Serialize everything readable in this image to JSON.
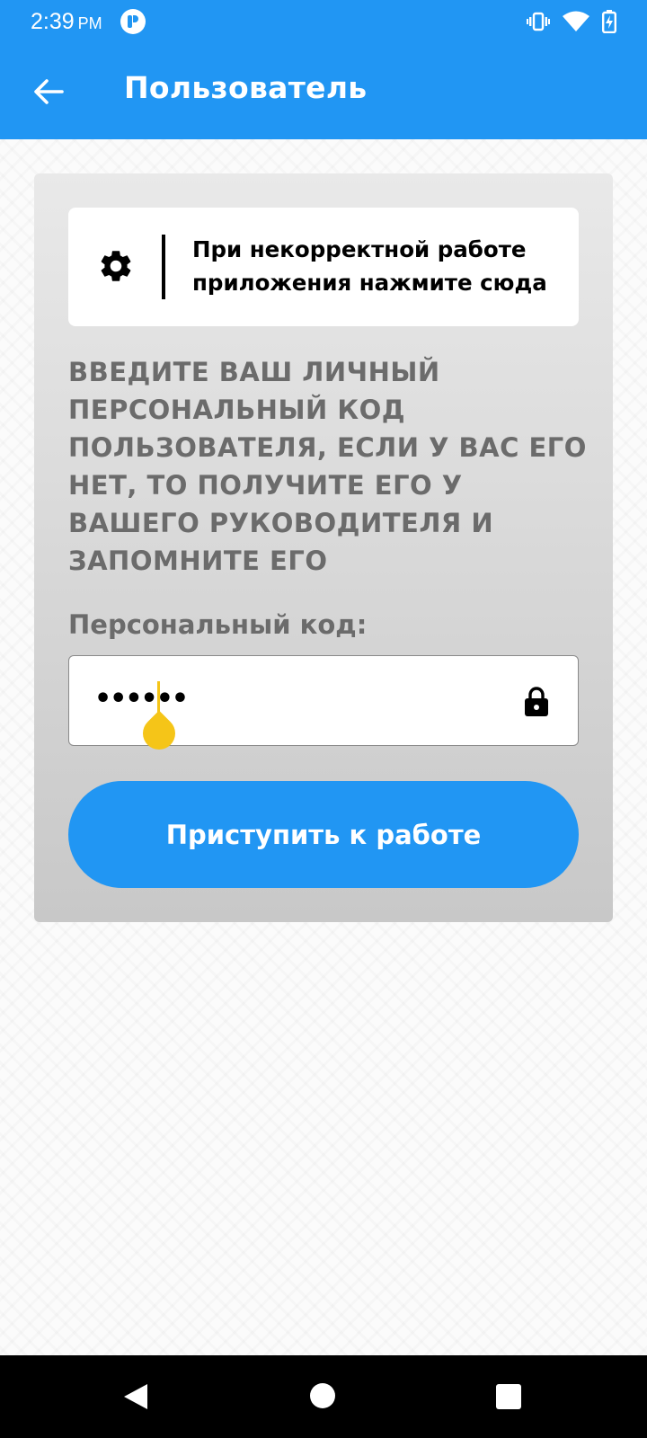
{
  "status_bar": {
    "time": "2:39",
    "ampm": "PM",
    "icons": [
      "app-notification-icon",
      "vibrate-icon",
      "wifi-icon",
      "battery-charging-icon"
    ]
  },
  "app_bar": {
    "title": "Пользователь",
    "back_icon": "arrow-left-icon"
  },
  "help_box": {
    "icon": "gear-icon",
    "text": "При некорректной работе приложения нажмите сюда"
  },
  "instruction": "ВВЕДИТЕ ВАШ ЛИЧНЫЙ ПЕРСОНАЛЬНЫЙ КОД ПОЛЬЗОВАТЕЛЯ, ЕСЛИ У ВАС ЕГО НЕТ, ТО ПОЛУЧИТЕ ЕГО У ВАШЕГО РУКОВОДИТЕЛЯ И ЗАПОМНИТЕ ЕГО",
  "code_field": {
    "label": "Персональный код:",
    "value": "••••••",
    "icon": "lock-icon"
  },
  "start_button": {
    "label": "Приступить к работе"
  },
  "colors": {
    "primary": "#2196f3",
    "cursor": "#f5c518",
    "muted_text": "#6b6b6b"
  }
}
